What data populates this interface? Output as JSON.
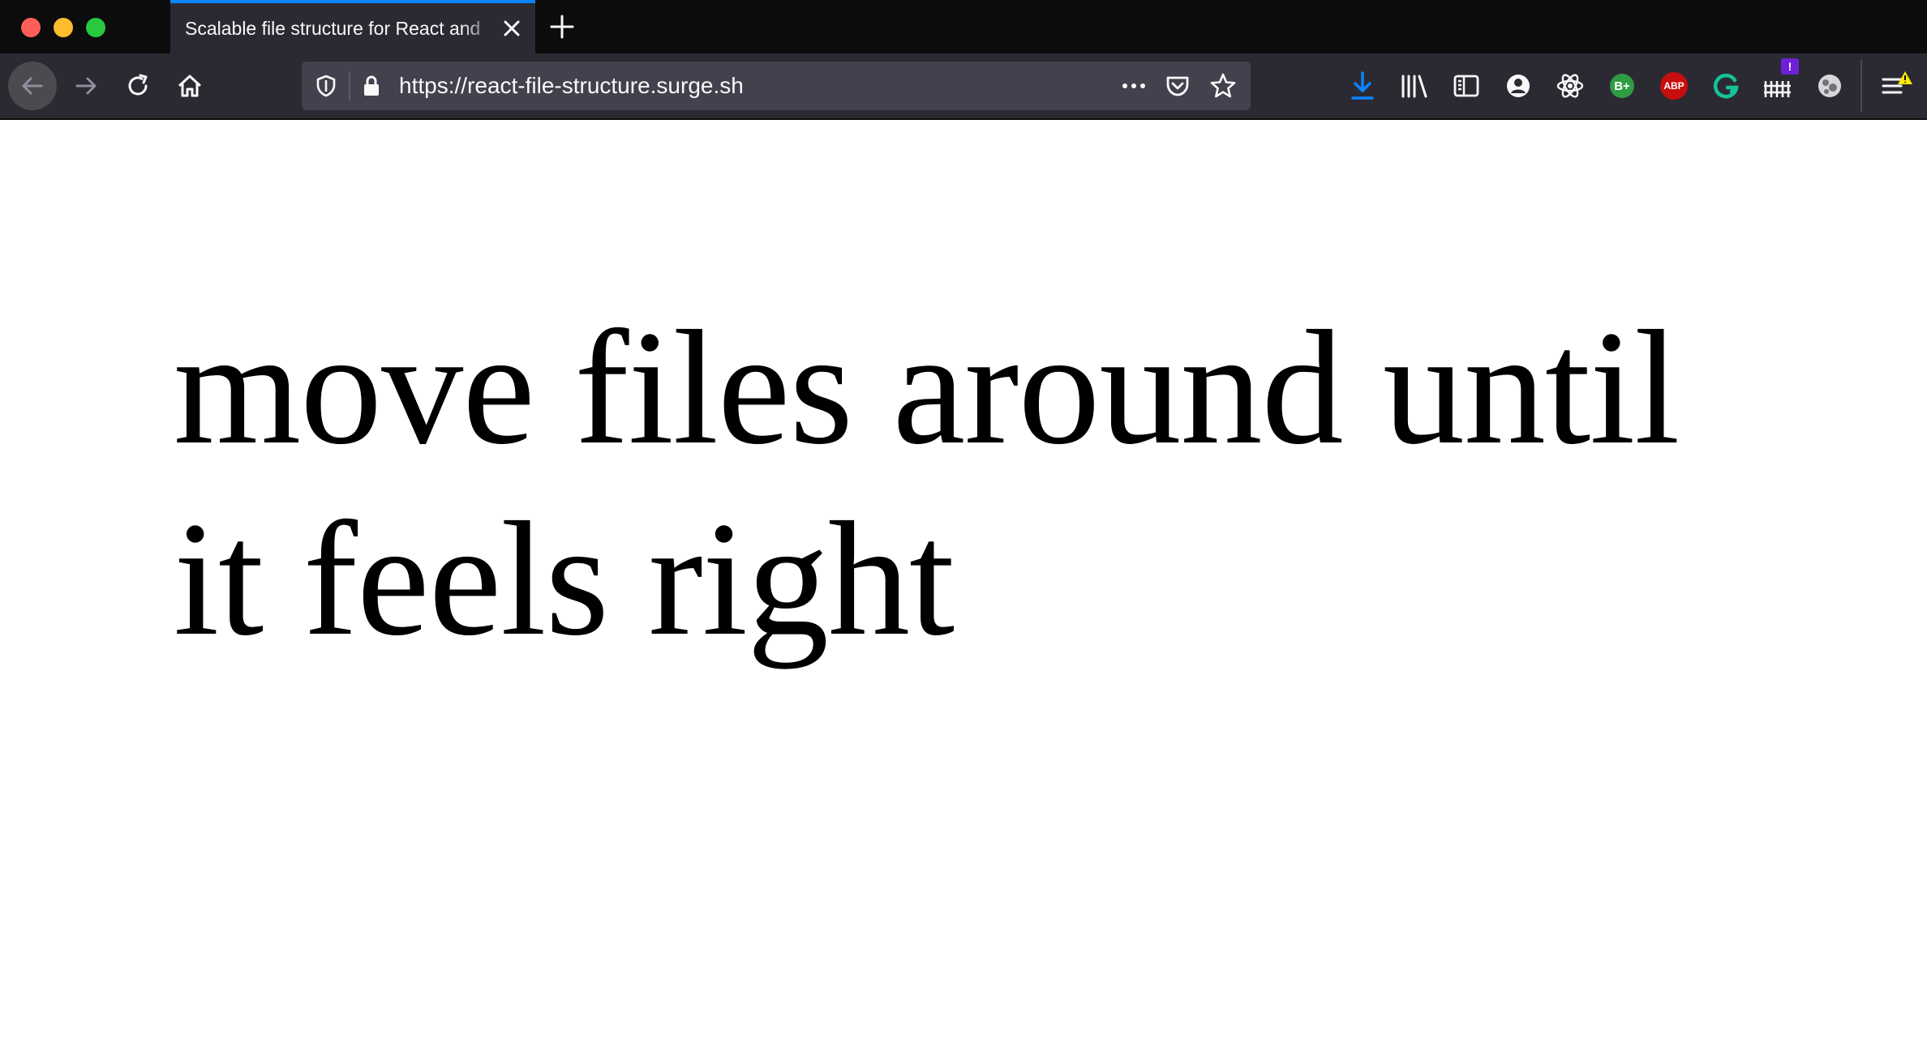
{
  "browser": {
    "tab_title": "Scalable file structure for React and",
    "url": "https://react-file-structure.surge.sh",
    "colors": {
      "chrome_dark": "#0c0c0d",
      "toolbar": "#2b2a33",
      "urlbar": "#42414d",
      "tab_accent": "#0a84ff"
    },
    "toolbar_icons": [
      "download-icon",
      "library-icon",
      "sidebar-icon",
      "account-icon",
      "react-devtools-icon",
      "bplus-extension-icon",
      "adblock-plus-icon",
      "grammarly-icon",
      "extension-icon",
      "extension-icon-2",
      "menu-icon"
    ],
    "badges": {
      "bplus": "B+",
      "abp": "ABP",
      "notice": "!"
    }
  },
  "page": {
    "headline_line1": "move files around until",
    "headline_line2": "it feels right"
  }
}
